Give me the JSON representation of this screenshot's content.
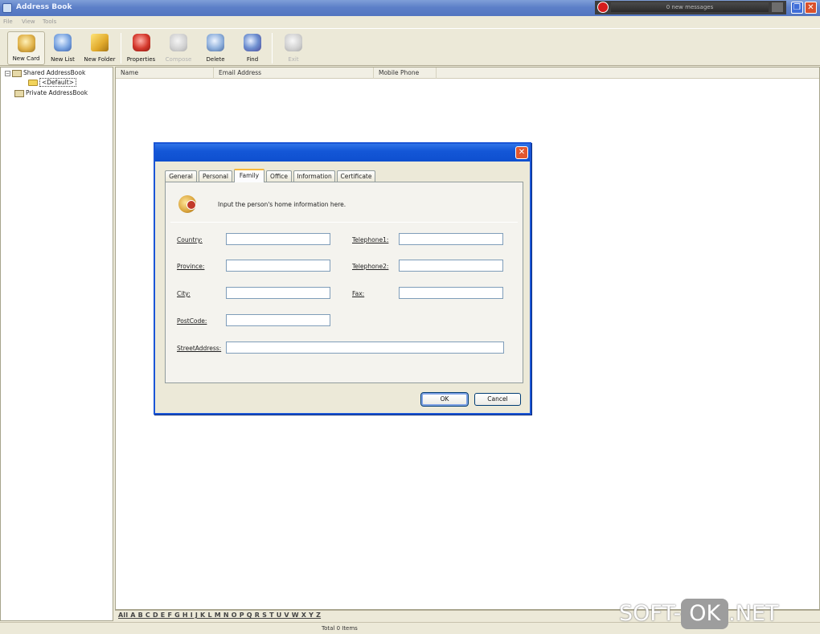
{
  "window": {
    "title": "Address Book",
    "messages_text": "0 new messages"
  },
  "menu": [
    "File",
    "View",
    "Tools"
  ],
  "toolbar": {
    "new_card": "New Card",
    "new_list": "New List",
    "new_folder": "New Folder",
    "properties": "Properties",
    "compose": "Compose",
    "delete": "Delete",
    "find": "Find",
    "exit": "Exit"
  },
  "tree": {
    "shared": "Shared AddressBook",
    "default": "<Default>",
    "private": "Private AddressBook"
  },
  "list": {
    "columns": [
      "Name",
      "Email Address",
      "Mobile Phone"
    ]
  },
  "alphabet": "All A B C D E F G H I J K L M N O P Q R S T U V W X Y Z",
  "status": "Total 0 Items",
  "watermark": {
    "left": "SOFT-",
    "mid": "OK",
    "right": ".NET"
  },
  "dialog": {
    "tabs": [
      "General",
      "Personal",
      "Family",
      "Office",
      "Information",
      "Certificate"
    ],
    "active_tab": "Family",
    "info_text": "Input the person's home information here.",
    "fields": {
      "country": {
        "label": "Country:",
        "value": ""
      },
      "province": {
        "label": "Province:",
        "value": ""
      },
      "city": {
        "label": "City:",
        "value": ""
      },
      "postcode": {
        "label": "PostCode:",
        "value": ""
      },
      "telephone1": {
        "label": "Telephone1:",
        "value": ""
      },
      "telephone2": {
        "label": "Telephone2:",
        "value": ""
      },
      "fax": {
        "label": "Fax:",
        "value": ""
      },
      "street": {
        "label": "StreetAddress:",
        "value": ""
      }
    },
    "ok": "OK",
    "cancel": "Cancel"
  },
  "colors": {
    "titlebar": "#5d80c8",
    "dialog_title": "#1457d7",
    "close": "#e2572f"
  }
}
